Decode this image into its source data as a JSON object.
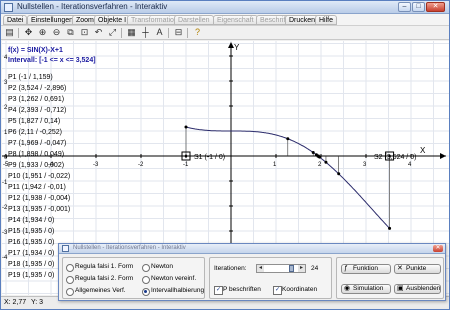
{
  "window": {
    "title": "Nullstellen - Iterationsverfahren - Interaktiv"
  },
  "menu": [
    "Datei",
    "Einstellungen",
    "Zoom",
    "Objekte I",
    "Transformation",
    "Darstellen",
    "Eigenschaft",
    "Beschriftung",
    "Drucken",
    "Hilfe"
  ],
  "menu_disabled": [
    false,
    false,
    false,
    false,
    true,
    true,
    true,
    true,
    false,
    false
  ],
  "toolbar_icons": [
    "print-icon",
    "move-icon",
    "zoom-in-icon",
    "zoom-out-icon",
    "zoom-window-icon",
    "zoom-reset-icon",
    "undo-icon",
    "zoom-fit-icon",
    "grid-icon",
    "axis-icon",
    "text-icon",
    "lock-icon",
    "help-icon"
  ],
  "plot": {
    "function_label": "f(x) = SIN(X)-X+1",
    "interval_label": "Intervall: [-1 <= x <= 3,524]",
    "x_axis_label": "X",
    "y_axis_label": "Y",
    "x_ticks": [
      "-5",
      "-4",
      "-3",
      "-2",
      "-1",
      "1",
      "2",
      "3",
      "4",
      "5"
    ],
    "y_ticks": [
      "5",
      "4",
      "3",
      "2",
      "1",
      "0",
      "-1",
      "-2",
      "-3",
      "-4"
    ],
    "points": [
      "P1 (-1 / 1,159)",
      "P2 (3,524 / -2,896)",
      "P3 (1,262 / 0,691)",
      "P4 (2,393 / -0,712)",
      "P5 (1,827 / 0,14)",
      "P6 (2,11 / -0,252)",
      "P7 (1,969 / -0,047)",
      "P8 (1,898 / 0,049)",
      "P9 (1,933 / 0,002)",
      "P10 (1,951 / -0,022)",
      "P11 (1,942 / -0,01)",
      "P12 (1,938 / -0,004)",
      "P13 (1,935 / -0,001)",
      "P14 (1,934 / 0)",
      "P15 (1,935 / 0)",
      "P16 (1,935 / 0)",
      "P17 (1,934 / 0)",
      "P18 (1,935 / 0)",
      "P19 (1,935 / 0)"
    ],
    "s1_label": "S1 (-1 / 0)",
    "s2_label": "S2 (3,524 / 0)"
  },
  "status": {
    "x": "X: 2,77",
    "y": "Y: 3"
  },
  "dialog": {
    "title": "Nullstellen - Iterationsverfahren - Interaktiv",
    "methods": [
      "Regula falsi 1. Form",
      "Regula falsi 2. Form",
      "Allgemeines Verf.",
      "Newton",
      "Newton vereinf.",
      "Intervallhalbierung"
    ],
    "selected_method": "Intervallhalbierung",
    "iterations_label": "Iterationen:",
    "iterations_value": "24",
    "iterations_fraction": 0.8,
    "points_label_check": "P beschriften",
    "coords_check": "Koordinaten",
    "btn_funktion": "Funktion",
    "btn_punkte": "Punkte",
    "btn_simulation": "Simulation",
    "btn_ausblenden": "Ausblenden"
  },
  "colors": {
    "curve": "#2a2a6a",
    "grid": "#e2e6ee",
    "accent": "#1a3a8a"
  }
}
